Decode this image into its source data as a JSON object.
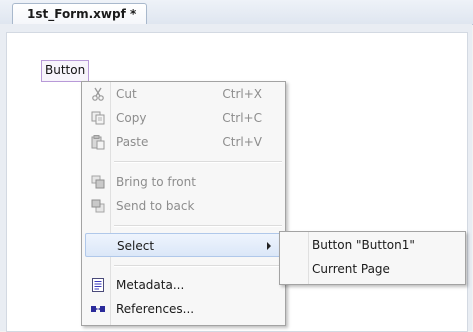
{
  "document_tab": {
    "title": "1st_Form.xwpf *"
  },
  "design_surface": {
    "button_label": "Button"
  },
  "context_menu": {
    "cut": {
      "label": "Cut",
      "shortcut": "Ctrl+X",
      "icon": "scissors-icon",
      "enabled": false
    },
    "copy": {
      "label": "Copy",
      "shortcut": "Ctrl+C",
      "icon": "copy-icon",
      "enabled": false
    },
    "paste": {
      "label": "Paste",
      "shortcut": "Ctrl+V",
      "icon": "paste-icon",
      "enabled": false
    },
    "bring_to_front": {
      "label": "Bring to front",
      "icon": "bring-to-front-icon",
      "enabled": false
    },
    "send_to_back": {
      "label": "Send to back",
      "icon": "send-to-back-icon",
      "enabled": false
    },
    "select": {
      "label": "Select",
      "highlighted": true
    },
    "metadata": {
      "label": "Metadata...",
      "icon": "metadata-icon",
      "enabled": true
    },
    "references": {
      "label": "References...",
      "icon": "references-icon",
      "enabled": true
    }
  },
  "select_submenu": {
    "items": [
      "Button \"Button1\"",
      "Current Page"
    ]
  }
}
